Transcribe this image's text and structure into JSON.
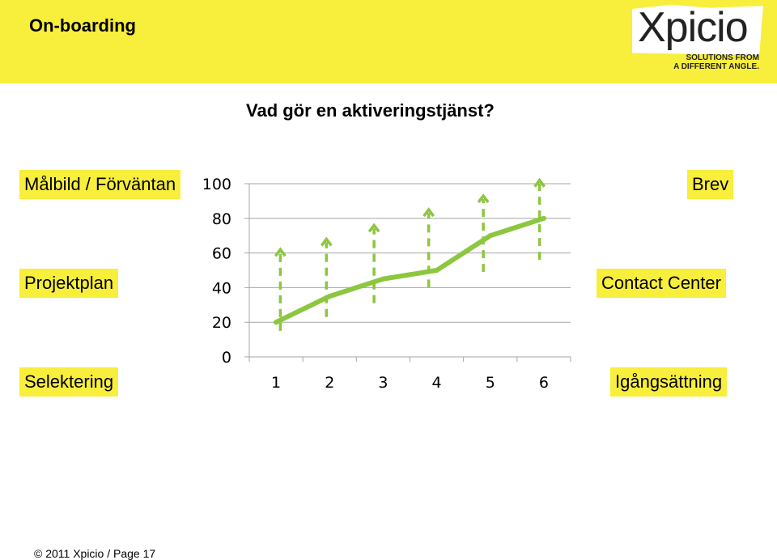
{
  "header": {
    "title": "On-boarding",
    "logo_text": "Xpicio",
    "logo_tagline_1": "SOLUTIONS FROM",
    "logo_tagline_2": "A DIFFERENT ANGLE."
  },
  "question": "Vad gör en aktiveringstjänst?",
  "labels": {
    "malbild": "Målbild / Förväntan",
    "projektplan": "Projektplan",
    "selektering": "Selektering",
    "brev": "Brev",
    "contact_center": "Contact Center",
    "igangsattning": "Igångsättning"
  },
  "footer": "© 2011 Xpicio / Page 17",
  "colors": {
    "band": "#f8ee3c",
    "line": "#8dc63f",
    "arrows": "#8dc63f"
  },
  "chart_data": {
    "type": "line",
    "categories": [
      "1",
      "2",
      "3",
      "4",
      "5",
      "6"
    ],
    "values": [
      20,
      35,
      45,
      50,
      70,
      80
    ],
    "ylim": [
      0,
      100
    ],
    "yticks": [
      "0",
      "20",
      "40",
      "60",
      "80",
      "100"
    ],
    "grid": true,
    "arrows": [
      {
        "x": 1.08,
        "from": 15,
        "to": 62
      },
      {
        "x": 1.94,
        "from": 23,
        "to": 68
      },
      {
        "x": 2.83,
        "from": 31,
        "to": 76
      },
      {
        "x": 3.85,
        "from": 40,
        "to": 85
      },
      {
        "x": 4.87,
        "from": 49,
        "to": 93
      },
      {
        "x": 5.92,
        "from": 56,
        "to": 102
      }
    ]
  }
}
